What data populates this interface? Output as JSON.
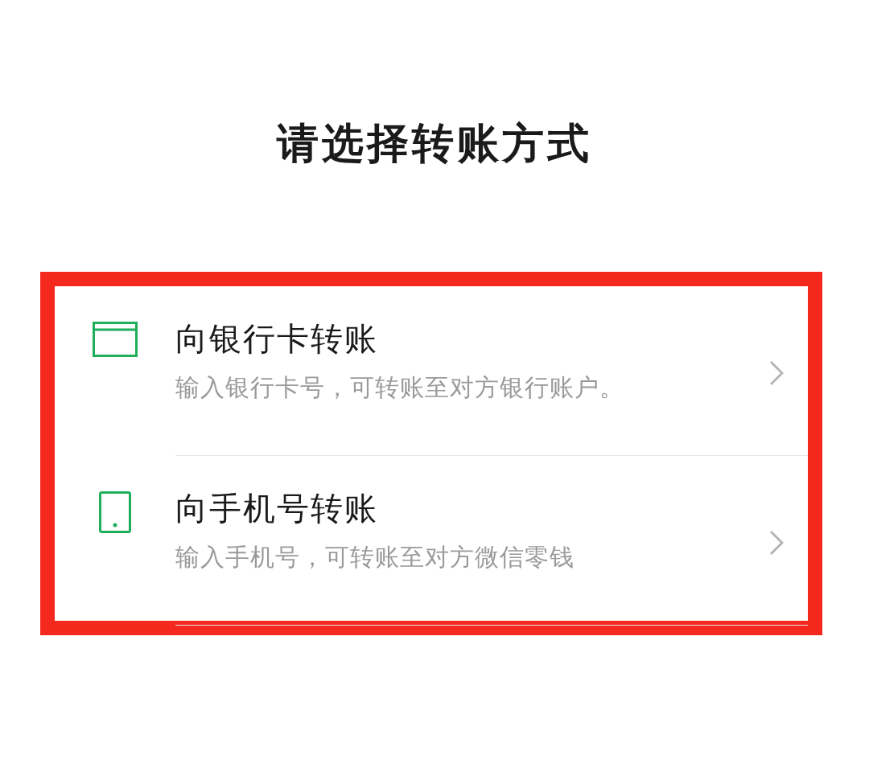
{
  "title": "请选择转账方式",
  "options": [
    {
      "kind": "card",
      "title": "向银行卡转账",
      "description": "输入银行卡号，可转账至对方银行账户。"
    },
    {
      "kind": "phone",
      "title": "向手机号转账",
      "description": "输入手机号，可转账至对方微信零钱"
    }
  ]
}
